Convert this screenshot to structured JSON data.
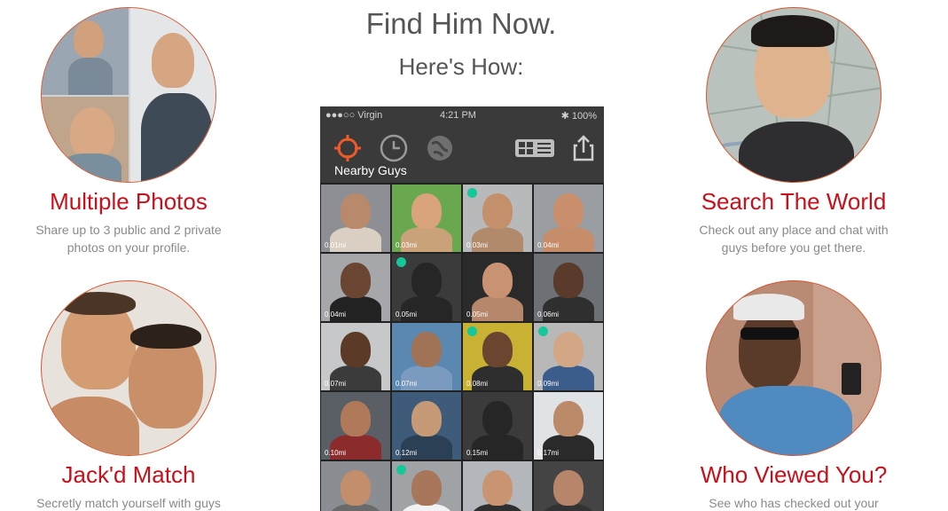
{
  "header": {
    "title": "Find Him Now.",
    "subtitle": "Here's How:"
  },
  "features": [
    {
      "title": "Multiple Photos",
      "desc": "Share up to 3 public and 2 private photos on your profile."
    },
    {
      "title": "Search The World",
      "desc": "Check out any place and chat with guys before you get there."
    },
    {
      "title": "Jack'd Match",
      "desc": "Secretly match yourself with guys"
    },
    {
      "title": "Who Viewed You?",
      "desc": "See who has checked out your profile"
    }
  ],
  "phone": {
    "carrier": "●●●○○ Virgin",
    "time": "4:21 PM",
    "battery": "✱ 100%",
    "tab_label": "Nearby Guys",
    "icons": [
      "nearby-target-icon",
      "clock-icon",
      "globe-icon",
      "grid-list-toggle-icon",
      "share-icon"
    ],
    "cells": [
      {
        "dist": "0.01mi",
        "online": false,
        "skin": "#b9896b",
        "bg": "#8d8f94",
        "shirt": "#d9cfc2"
      },
      {
        "dist": "0.03mi",
        "online": false,
        "skin": "#d9a37c",
        "bg": "#6aa84f",
        "shirt": "#c9a27a"
      },
      {
        "dist": "0.03mi",
        "online": true,
        "skin": "#c4906c",
        "bg": "#b7b9bb",
        "shirt": "#b08a6a"
      },
      {
        "dist": "0.04mi",
        "online": false,
        "skin": "#c98f6c",
        "bg": "#9a9da1",
        "shirt": "#c58d6a"
      },
      {
        "dist": "0.04mi",
        "online": false,
        "skin": "#6a4532",
        "bg": "#a5a7aa",
        "shirt": "#222222"
      },
      {
        "dist": "0.05mi",
        "online": true,
        "placeholder": true
      },
      {
        "dist": "0.05mi",
        "online": false,
        "skin": "#c99373",
        "bg": "#2a2a2a",
        "shirt": "#b6876b"
      },
      {
        "dist": "0.06mi",
        "online": false,
        "skin": "#5a3a2a",
        "bg": "#6d7075",
        "shirt": "#2f2f2f"
      },
      {
        "dist": "0.07mi",
        "online": false,
        "skin": "#5b3a28",
        "bg": "#c7c8c9",
        "shirt": "#3b3b3b"
      },
      {
        "dist": "0.07mi",
        "online": false,
        "skin": "#a07357",
        "bg": "#5b88b0",
        "shirt": "#7a9ac0"
      },
      {
        "dist": "0.08mi",
        "online": true,
        "skin": "#6b4530",
        "bg": "#c9b233",
        "shirt": "#2e2e2e"
      },
      {
        "dist": "0.09mi",
        "online": true,
        "skin": "#d3a786",
        "bg": "#b8b8b8",
        "shirt": "#3c5c8c"
      },
      {
        "dist": "0.10mi",
        "online": false,
        "skin": "#b07a5a",
        "bg": "#5a5f66",
        "shirt": "#8b2b2b"
      },
      {
        "dist": "0.12mi",
        "online": false,
        "skin": "#c69a76",
        "bg": "#3f5b7a",
        "shirt": "#2b3f55"
      },
      {
        "dist": "0.15mi",
        "online": false,
        "placeholder": true
      },
      {
        "dist": "0.17mi",
        "online": false,
        "skin": "#bb8a68",
        "bg": "#dfe3e6",
        "shirt": "#2a2a2a"
      },
      {
        "dist": "",
        "online": false,
        "skin": "#c28e6c",
        "bg": "#8a8d92",
        "shirt": "#6a6a6a"
      },
      {
        "dist": "",
        "online": true,
        "skin": "#a8765a",
        "bg": "#a0a3a6",
        "shirt": "#f2f2f2"
      },
      {
        "dist": "",
        "online": false,
        "skin": "#c89471",
        "bg": "#b3b7bb",
        "shirt": "#2f2f2f"
      },
      {
        "dist": "",
        "online": false,
        "skin": "#b7856a",
        "bg": "#444444",
        "shirt": "#333333"
      }
    ]
  },
  "colors": {
    "accent": "#c8101a",
    "circle_border": "#d9542c",
    "online": "#16c79a"
  }
}
